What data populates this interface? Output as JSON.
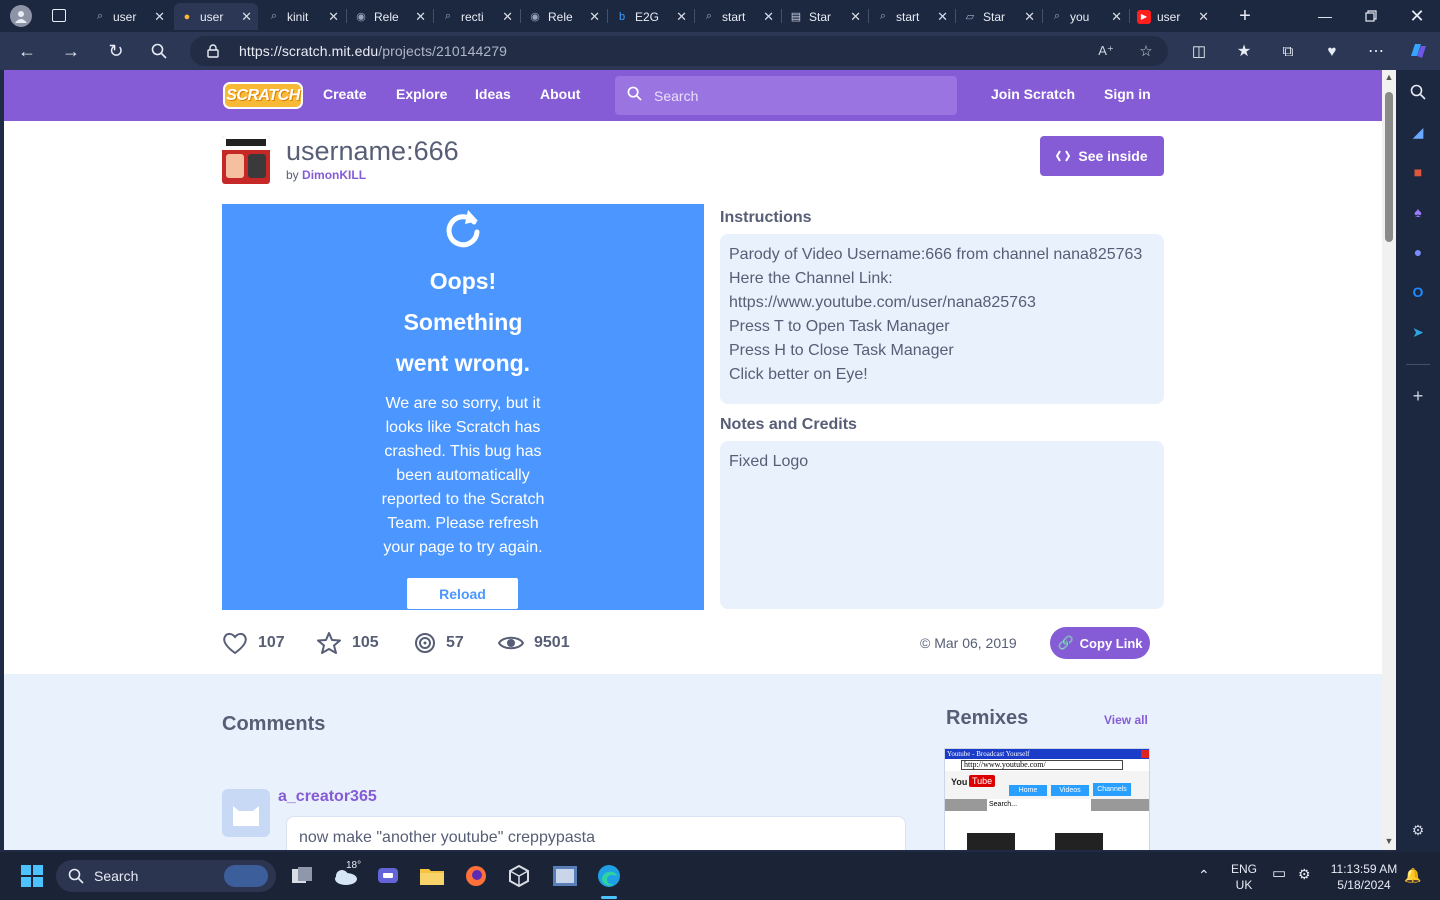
{
  "browser": {
    "tabs": [
      {
        "label": "user",
        "icon": "search-icon",
        "active": false
      },
      {
        "label": "user",
        "icon": "scratch-icon",
        "active": true
      },
      {
        "label": "kinit",
        "icon": "search-icon",
        "active": false
      },
      {
        "label": "Rele",
        "icon": "github-icon",
        "active": false
      },
      {
        "label": "recti",
        "icon": "search-icon",
        "active": false
      },
      {
        "label": "Rele",
        "icon": "github-icon",
        "active": false
      },
      {
        "label": "E2G",
        "icon": "bing-icon",
        "active": false
      },
      {
        "label": "start",
        "icon": "search-icon",
        "active": false
      },
      {
        "label": "Star",
        "icon": "doc-icon",
        "active": false
      },
      {
        "label": "start",
        "icon": "search-icon",
        "active": false
      },
      {
        "label": "Star",
        "icon": "page-icon",
        "active": false
      },
      {
        "label": "you",
        "icon": "search-icon",
        "active": false
      },
      {
        "label": "user",
        "icon": "youtube-icon",
        "active": false
      }
    ],
    "url_host": "https://scratch.mit.edu",
    "url_path": "/projects/210144279"
  },
  "scratch": {
    "logo": "SCRATCH",
    "nav": {
      "create": "Create",
      "explore": "Explore",
      "ideas": "Ideas",
      "about": "About",
      "join": "Join Scratch",
      "signin": "Sign in"
    },
    "search_placeholder": "Search"
  },
  "project": {
    "title": "username:666",
    "by_prefix": "by",
    "author": "DimonKILL",
    "see_inside": "See inside",
    "crash": {
      "oops": "Oops!",
      "line2": "Something",
      "line3": "went wrong.",
      "message": "We are so sorry, but it looks like Scratch has crashed. This bug has been automatically reported to the Scratch Team. Please refresh your page to try again.",
      "reload": "Reload"
    },
    "instructions_heading": "Instructions",
    "instructions": [
      "Parody of Video Username:666 from channel nana825763",
      "Here the Channel Link:",
      "https://www.youtube.com/user/nana825763",
      "Press T to Open Task Manager",
      "Press H to Close Task Manager",
      "Click better on Eye!"
    ],
    "notes_heading": "Notes and Credits",
    "notes": "Fixed Logo",
    "stats": {
      "loves": "107",
      "favorites": "105",
      "remixes": "57",
      "views": "9501"
    },
    "date": "© Mar 06, 2019",
    "copy_link": "Copy Link"
  },
  "comments": {
    "heading": "Comments",
    "items": [
      {
        "user": "a_creator365",
        "text": "now make \"another youtube\" creppypasta"
      }
    ]
  },
  "remixes": {
    "heading": "Remixes",
    "view_all": "View all",
    "thumb": {
      "title": "Youtube - Broadcast Yourself",
      "url": "http://www.youtube.com/",
      "logo_you": "You",
      "logo_tube": "Tube",
      "tabs": [
        "Home",
        "Videos",
        "Channels"
      ],
      "search": "Search..."
    }
  },
  "taskbar": {
    "search": "Search",
    "weather": "18°",
    "lang_top": "ENG",
    "lang_bottom": "UK",
    "time": "11:13:59 AM",
    "date": "5/18/2024"
  },
  "colors": {
    "scratch_purple": "#855cd6",
    "stage_blue": "#4c97ff",
    "text_gray": "#575e75",
    "box_blue": "#e9f1fc"
  }
}
